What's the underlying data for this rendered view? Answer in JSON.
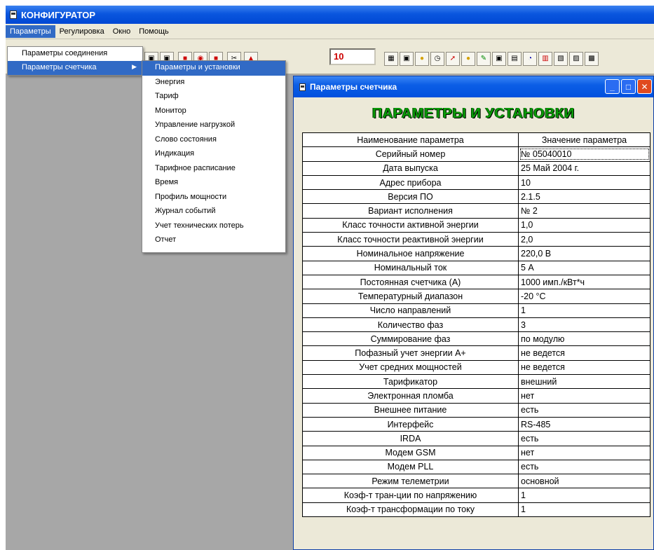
{
  "app": {
    "title": "КОНФИГУРАТОР"
  },
  "menubar": {
    "items": [
      "Параметры",
      "Регулировка",
      "Окно",
      "Помощь"
    ]
  },
  "toolbar": {
    "number_value": "10"
  },
  "params_menu": {
    "items": [
      "Параметры соединения",
      "Параметры счетчика"
    ]
  },
  "meter_submenu": {
    "items": [
      "Параметры и установки",
      "Энергия",
      "Тариф",
      "Монитор",
      "Управление нагрузкой",
      "Слово состояния",
      "Индикация",
      "Тарифное расписание",
      "Время",
      "Профиль мощности",
      "Журнал событий",
      "Учет технических потерь",
      "Отчет"
    ]
  },
  "child_window": {
    "title": "Параметры счетчика",
    "heading": "ПАРАМЕТРЫ И УСТАНОВКИ",
    "table": {
      "headers": [
        "Наименование параметра",
        "Значение параметра"
      ],
      "rows": [
        [
          "Серийный номер",
          "№ 05040010"
        ],
        [
          "Дата выпуска",
          "25 Май 2004 г."
        ],
        [
          "Адрес прибора",
          "10"
        ],
        [
          "Версия ПО",
          "2.1.5"
        ],
        [
          "Вариант исполнения",
          "№ 2"
        ],
        [
          "Класс точности активной энергии",
          "1,0"
        ],
        [
          "Класс точности реактивной энергии",
          "2,0"
        ],
        [
          "Номинальное напряжение",
          "220,0 В"
        ],
        [
          "Номинальный ток",
          "5 А"
        ],
        [
          "Постоянная счетчика (А)",
          "1000 имп./кВт*ч"
        ],
        [
          "Температурный диапазон",
          "-20 °С"
        ],
        [
          "Число направлений",
          "1"
        ],
        [
          "Количество фаз",
          "3"
        ],
        [
          "Суммирование фаз",
          "по модулю"
        ],
        [
          "Пофазный учет энергии А+",
          "не ведется"
        ],
        [
          "Учет средних мощностей",
          "не ведется"
        ],
        [
          "Тарификатор",
          "внешний"
        ],
        [
          "Электронная пломба",
          "нет"
        ],
        [
          "Внешнее питание",
          "есть"
        ],
        [
          "Интерфейс",
          "RS-485"
        ],
        [
          "IRDA",
          "есть"
        ],
        [
          "Модем GSM",
          "нет"
        ],
        [
          "Модем PLL",
          "есть"
        ],
        [
          "Режим телеметрии",
          "основной"
        ],
        [
          "Коэф-т тран-ции по напряжению",
          "1"
        ],
        [
          "Коэф-т трансформации по току",
          "1"
        ]
      ]
    }
  },
  "colors": {
    "titlebar": "#0a56de",
    "menu_highlight": "#316ac5",
    "heading_green": "#0a9a08",
    "workspace": "#a7a7a7"
  }
}
